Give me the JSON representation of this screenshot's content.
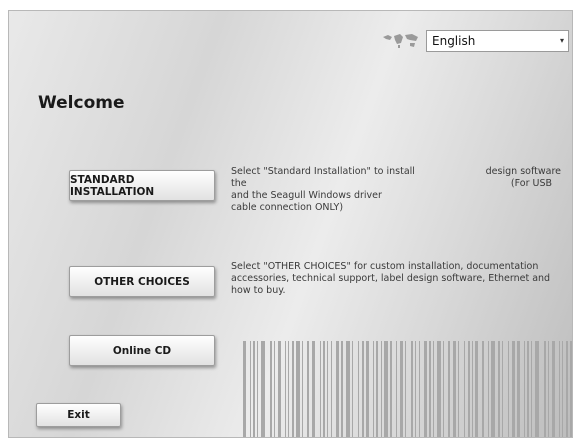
{
  "language": {
    "icon": "globe-map-icon",
    "selected": "English",
    "arrow": "▾"
  },
  "welcome": "Welcome",
  "buttons": {
    "standard": "STANDARD INSTALLATION",
    "other": "OTHER CHOICES",
    "online_cd": "Online CD",
    "exit": "Exit"
  },
  "descriptions": {
    "standard_lines": [
      "Select \"Standard Installation\" to install the",
      "and the Seagull Windows driver",
      "cable connection ONLY)"
    ],
    "standard_right_lines": [
      "design software",
      "(For USB"
    ],
    "other_lines": [
      "Select \"OTHER CHOICES\" for custom installation, documentation",
      "accessories, technical support, label design software, Ethernet and",
      "how to buy."
    ]
  },
  "decor": {
    "barcode": "barcode-graphic"
  },
  "colors": {
    "background": "#d6d6d6",
    "button_top": "#ffffff",
    "button_bottom": "#e2e2e2",
    "barcode": "#a8a8a8"
  }
}
